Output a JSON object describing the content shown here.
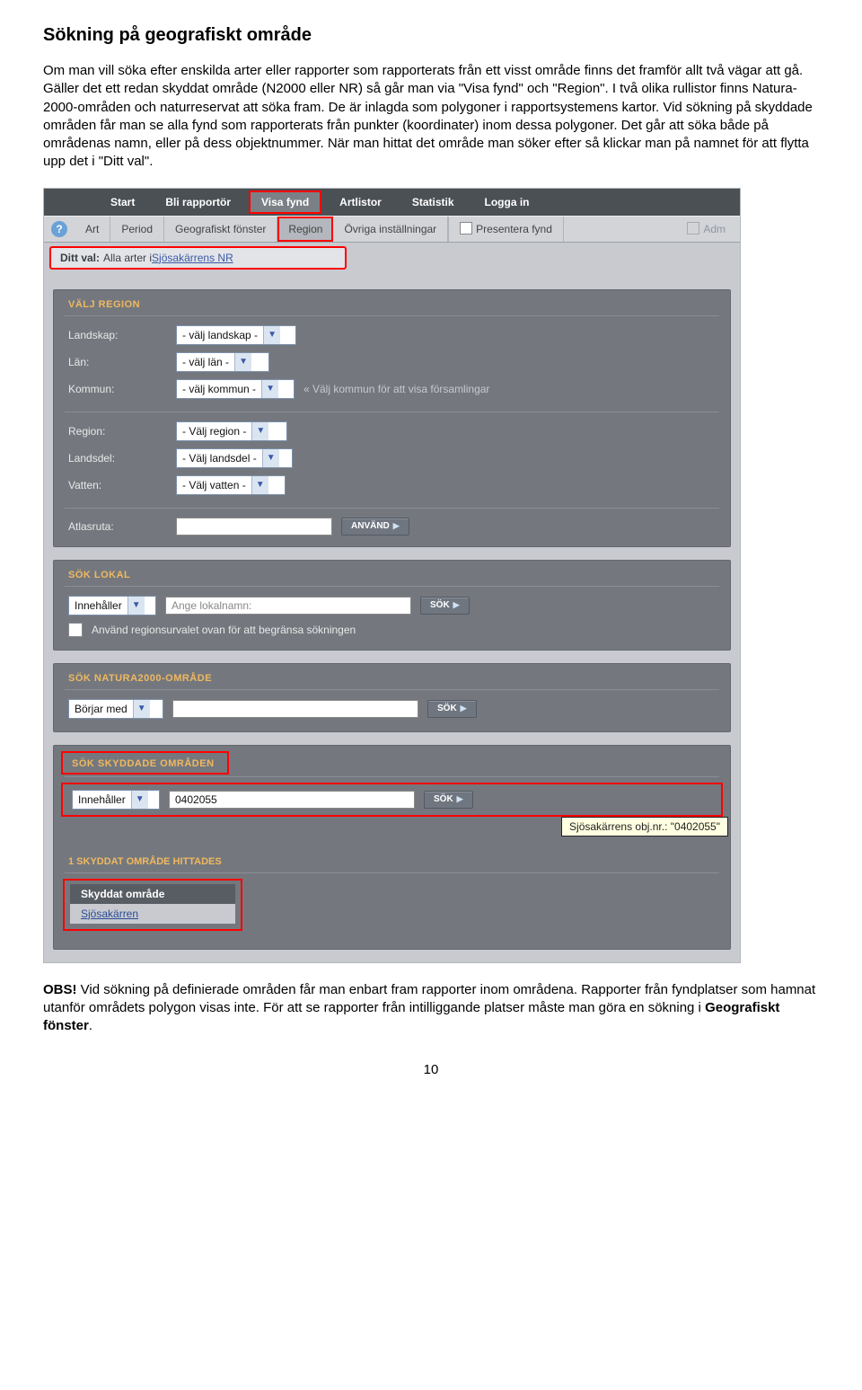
{
  "doc": {
    "heading": "Sökning på geografiskt område",
    "para1": "Om man vill söka efter enskilda arter eller rapporter som rapporterats från ett visst område finns det framför allt två vägar att gå. Gäller det ett redan skyddat område (N2000 eller NR) så går man via \"Visa fynd\" och \"Region\". I två olika rullistor finns Natura-2000-områden och naturreservat att söka fram. De är inlagda som polygoner i rapportsystemens kartor. Vid sökning på skyddade områden får man se alla fynd som rapporterats från punkter (koordinater) inom dessa polygoner. Det går att söka både på områdenas namn, eller på dess objektnummer. När man hittat det område man söker efter så klickar man på namnet för att flytta upp det i \"Ditt val\".",
    "para2_prefix": "OBS!",
    "para2": " Vid sökning på definierade områden får man enbart fram rapporter inom områdena. Rapporter från fyndplatser som hamnat utanför områdets polygon visas inte. För att se rapporter från intilliggande platser måste man göra en sökning i ",
    "para2_bold": "Geografiskt fönster",
    "para2_suffix": ".",
    "page_number": "10"
  },
  "ui": {
    "topnav": {
      "start": "Start",
      "bli": "Bli rapportör",
      "visa": "Visa fynd",
      "art": "Artlistor",
      "stat": "Statistik",
      "login": "Logga in"
    },
    "subtabs": {
      "art": "Art",
      "period": "Period",
      "geo": "Geografiskt fönster",
      "region": "Region",
      "ovriga": "Övriga inställningar",
      "present": "Presentera fynd",
      "adm": "Adm"
    },
    "selection": {
      "label": "Ditt val:",
      "text": "Alla arter i ",
      "link": "Sjösakärrens NR"
    },
    "region_panel": {
      "title": "VÄLJ REGION",
      "rows": {
        "landskap": {
          "label": "Landskap:",
          "value": "- välj landskap -"
        },
        "lan": {
          "label": "Län:",
          "value": "- välj län -"
        },
        "kommun": {
          "label": "Kommun:",
          "value": "- välj kommun -",
          "hint": "« Välj kommun för att visa församlingar"
        },
        "region": {
          "label": "Region:",
          "value": "- Välj region -"
        },
        "landsdel": {
          "label": "Landsdel:",
          "value": "- Välj landsdel -"
        },
        "vatten": {
          "label": "Vatten:",
          "value": "- Välj vatten -"
        },
        "atlas": {
          "label": "Atlasruta:",
          "btn": "ANVÄND"
        }
      }
    },
    "lokal_panel": {
      "title": "SÖK LOKAL",
      "mode": "Innehåller",
      "placeholder": "Ange lokalnamn:",
      "btn": "SÖK",
      "checkbox_label": "Använd regionsurvalet ovan för att begränsa sökningen"
    },
    "n2000_panel": {
      "title": "SÖK NATURA2000-OMRÅDE",
      "mode": "Börjar med",
      "btn": "SÖK"
    },
    "protected_panel": {
      "title": "SÖK SKYDDADE OMRÅDEN",
      "mode": "Innehåller",
      "value": "0402055",
      "btn": "SÖK",
      "tooltip": "Sjösakärrens obj.nr.: \"0402055\""
    },
    "results": {
      "count_title": "1 SKYDDAT OMRÅDE HITTADES",
      "header": "Skyddat område",
      "item": "Sjösakärren"
    }
  }
}
